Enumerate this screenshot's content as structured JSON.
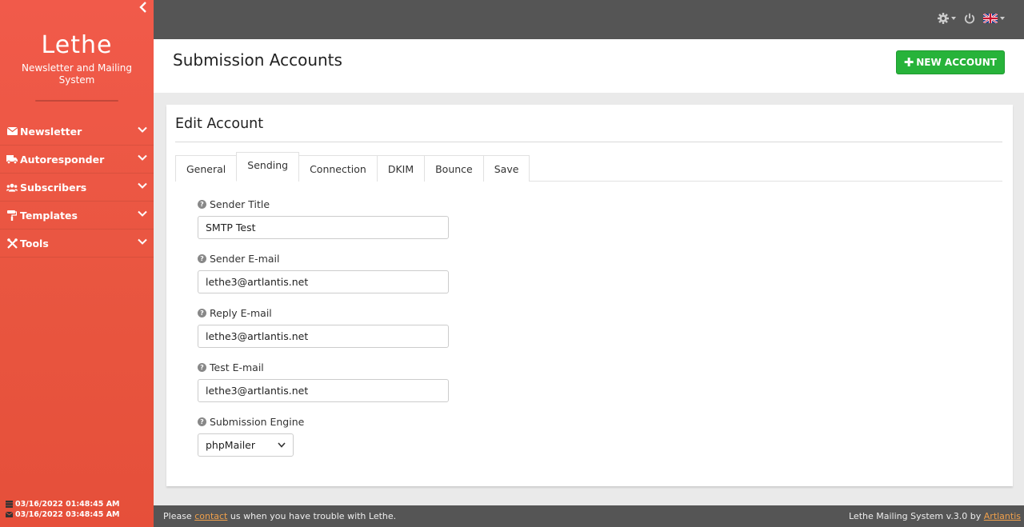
{
  "brand": {
    "title": "Lethe",
    "subtitle": "Newsletter and Mailing System"
  },
  "sidebar": {
    "items": [
      {
        "label": "Newsletter",
        "icon": "envelope-icon"
      },
      {
        "label": "Autoresponder",
        "icon": "truck-icon"
      },
      {
        "label": "Subscribers",
        "icon": "users-icon"
      },
      {
        "label": "Templates",
        "icon": "paint-roller-icon"
      },
      {
        "label": "Tools",
        "icon": "tools-icon"
      }
    ],
    "times": [
      {
        "icon": "server-icon",
        "value": "03/16/2022 01:48:45 AM"
      },
      {
        "icon": "envelope-icon",
        "value": "03/16/2022 03:48:45 AM"
      }
    ]
  },
  "header": {
    "page_title": "Submission Accounts",
    "new_button_label": "NEW ACCOUNT"
  },
  "card": {
    "title": "Edit Account",
    "tabs": [
      {
        "label": "General",
        "active": false
      },
      {
        "label": "Sending",
        "active": true
      },
      {
        "label": "Connection",
        "active": false
      },
      {
        "label": "DKIM",
        "active": false
      },
      {
        "label": "Bounce",
        "active": false
      },
      {
        "label": "Save",
        "active": false
      }
    ]
  },
  "form": {
    "sender_title": {
      "label": "Sender Title",
      "value": "SMTP Test"
    },
    "sender_email": {
      "label": "Sender E-mail",
      "value": "lethe3@artlantis.net"
    },
    "reply_email": {
      "label": "Reply E-mail",
      "value": "lethe3@artlantis.net"
    },
    "test_email": {
      "label": "Test E-mail",
      "value": "lethe3@artlantis.net"
    },
    "submission_engine": {
      "label": "Submission Engine",
      "value": "phpMailer"
    }
  },
  "footer": {
    "left_prefix": "Please",
    "left_link": "contact",
    "left_suffix": "us when you have trouble with Lethe.",
    "right_prefix": "Lethe Mailing System v.3.0 by",
    "right_link": "Artlantis"
  },
  "colors": {
    "sidebar": "#e8553f",
    "topbar": "#555555",
    "accent_green": "#27b33a",
    "link_orange": "#f0a04b"
  }
}
